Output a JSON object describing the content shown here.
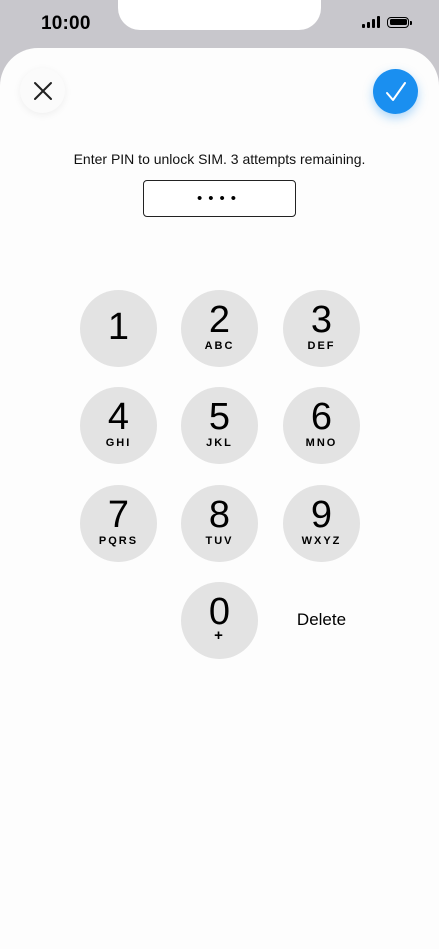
{
  "status_bar": {
    "time": "10:00",
    "icons": [
      "signal-icon",
      "battery-icon"
    ]
  },
  "header": {
    "close_icon": "close-icon",
    "confirm_icon": "checkmark-icon",
    "accent_color": "#1a8ff0"
  },
  "prompt": "Enter PIN to unlock SIM. 3 attempts remaining.",
  "pin_field": {
    "value": "••••"
  },
  "keypad": {
    "keys": [
      {
        "digit": "1",
        "letters": ""
      },
      {
        "digit": "2",
        "letters": "ABC"
      },
      {
        "digit": "3",
        "letters": "DEF"
      },
      {
        "digit": "4",
        "letters": "GHI"
      },
      {
        "digit": "5",
        "letters": "JKL"
      },
      {
        "digit": "6",
        "letters": "MNO"
      },
      {
        "digit": "7",
        "letters": "PQRS"
      },
      {
        "digit": "8",
        "letters": "TUV"
      },
      {
        "digit": "9",
        "letters": "WXYZ"
      },
      {
        "digit": "0",
        "letters": "+"
      }
    ],
    "delete_label": "Delete"
  }
}
